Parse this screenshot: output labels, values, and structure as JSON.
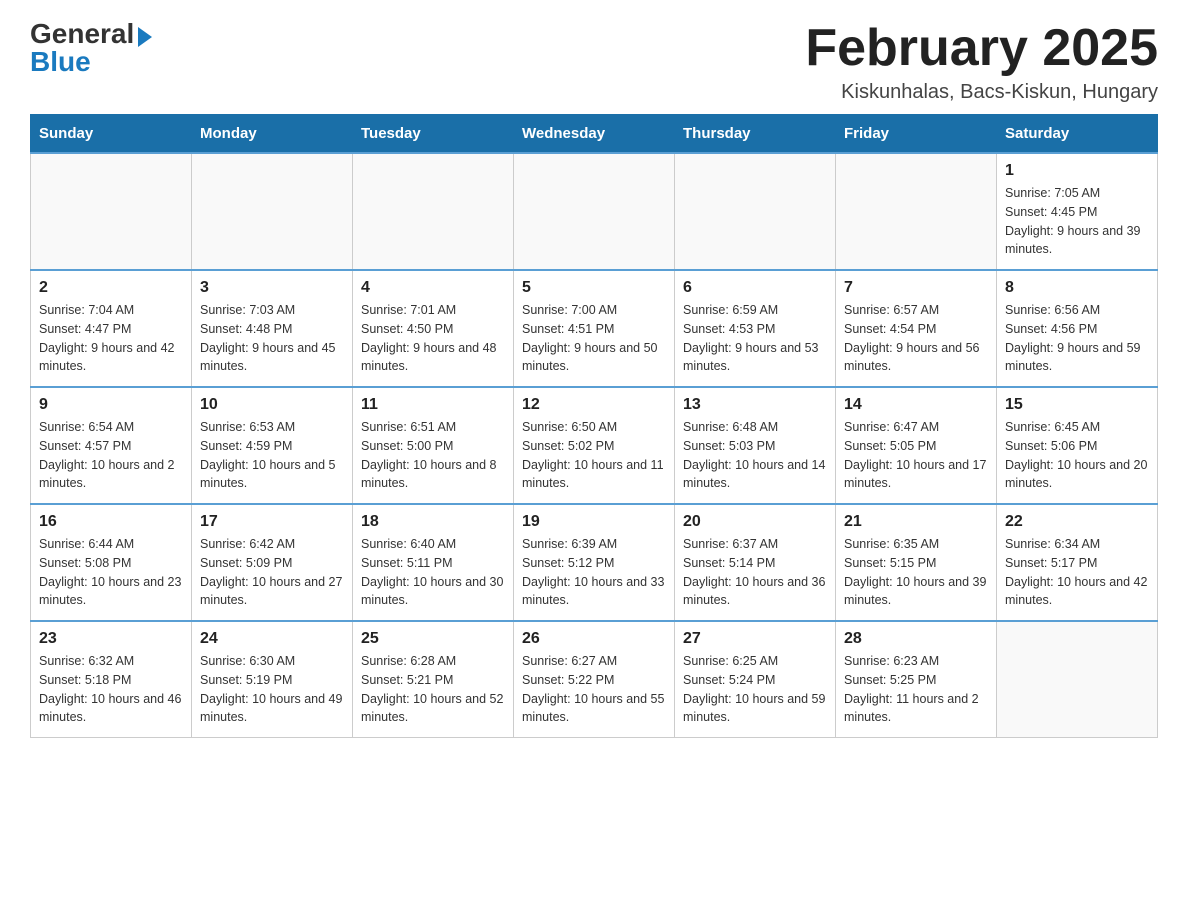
{
  "logo": {
    "general": "General",
    "blue": "Blue",
    "arrow": "▶"
  },
  "title": "February 2025",
  "location": "Kiskunhalas, Bacs-Kiskun, Hungary",
  "days_of_week": [
    "Sunday",
    "Monday",
    "Tuesday",
    "Wednesday",
    "Thursday",
    "Friday",
    "Saturday"
  ],
  "weeks": [
    [
      {
        "day": "",
        "detail": "",
        "empty": true
      },
      {
        "day": "",
        "detail": "",
        "empty": true
      },
      {
        "day": "",
        "detail": "",
        "empty": true
      },
      {
        "day": "",
        "detail": "",
        "empty": true
      },
      {
        "day": "",
        "detail": "",
        "empty": true
      },
      {
        "day": "",
        "detail": "",
        "empty": true
      },
      {
        "day": "1",
        "detail": "Sunrise: 7:05 AM\nSunset: 4:45 PM\nDaylight: 9 hours and 39 minutes."
      }
    ],
    [
      {
        "day": "2",
        "detail": "Sunrise: 7:04 AM\nSunset: 4:47 PM\nDaylight: 9 hours and 42 minutes."
      },
      {
        "day": "3",
        "detail": "Sunrise: 7:03 AM\nSunset: 4:48 PM\nDaylight: 9 hours and 45 minutes."
      },
      {
        "day": "4",
        "detail": "Sunrise: 7:01 AM\nSunset: 4:50 PM\nDaylight: 9 hours and 48 minutes."
      },
      {
        "day": "5",
        "detail": "Sunrise: 7:00 AM\nSunset: 4:51 PM\nDaylight: 9 hours and 50 minutes."
      },
      {
        "day": "6",
        "detail": "Sunrise: 6:59 AM\nSunset: 4:53 PM\nDaylight: 9 hours and 53 minutes."
      },
      {
        "day": "7",
        "detail": "Sunrise: 6:57 AM\nSunset: 4:54 PM\nDaylight: 9 hours and 56 minutes."
      },
      {
        "day": "8",
        "detail": "Sunrise: 6:56 AM\nSunset: 4:56 PM\nDaylight: 9 hours and 59 minutes."
      }
    ],
    [
      {
        "day": "9",
        "detail": "Sunrise: 6:54 AM\nSunset: 4:57 PM\nDaylight: 10 hours and 2 minutes."
      },
      {
        "day": "10",
        "detail": "Sunrise: 6:53 AM\nSunset: 4:59 PM\nDaylight: 10 hours and 5 minutes."
      },
      {
        "day": "11",
        "detail": "Sunrise: 6:51 AM\nSunset: 5:00 PM\nDaylight: 10 hours and 8 minutes."
      },
      {
        "day": "12",
        "detail": "Sunrise: 6:50 AM\nSunset: 5:02 PM\nDaylight: 10 hours and 11 minutes."
      },
      {
        "day": "13",
        "detail": "Sunrise: 6:48 AM\nSunset: 5:03 PM\nDaylight: 10 hours and 14 minutes."
      },
      {
        "day": "14",
        "detail": "Sunrise: 6:47 AM\nSunset: 5:05 PM\nDaylight: 10 hours and 17 minutes."
      },
      {
        "day": "15",
        "detail": "Sunrise: 6:45 AM\nSunset: 5:06 PM\nDaylight: 10 hours and 20 minutes."
      }
    ],
    [
      {
        "day": "16",
        "detail": "Sunrise: 6:44 AM\nSunset: 5:08 PM\nDaylight: 10 hours and 23 minutes."
      },
      {
        "day": "17",
        "detail": "Sunrise: 6:42 AM\nSunset: 5:09 PM\nDaylight: 10 hours and 27 minutes."
      },
      {
        "day": "18",
        "detail": "Sunrise: 6:40 AM\nSunset: 5:11 PM\nDaylight: 10 hours and 30 minutes."
      },
      {
        "day": "19",
        "detail": "Sunrise: 6:39 AM\nSunset: 5:12 PM\nDaylight: 10 hours and 33 minutes."
      },
      {
        "day": "20",
        "detail": "Sunrise: 6:37 AM\nSunset: 5:14 PM\nDaylight: 10 hours and 36 minutes."
      },
      {
        "day": "21",
        "detail": "Sunrise: 6:35 AM\nSunset: 5:15 PM\nDaylight: 10 hours and 39 minutes."
      },
      {
        "day": "22",
        "detail": "Sunrise: 6:34 AM\nSunset: 5:17 PM\nDaylight: 10 hours and 42 minutes."
      }
    ],
    [
      {
        "day": "23",
        "detail": "Sunrise: 6:32 AM\nSunset: 5:18 PM\nDaylight: 10 hours and 46 minutes."
      },
      {
        "day": "24",
        "detail": "Sunrise: 6:30 AM\nSunset: 5:19 PM\nDaylight: 10 hours and 49 minutes."
      },
      {
        "day": "25",
        "detail": "Sunrise: 6:28 AM\nSunset: 5:21 PM\nDaylight: 10 hours and 52 minutes."
      },
      {
        "day": "26",
        "detail": "Sunrise: 6:27 AM\nSunset: 5:22 PM\nDaylight: 10 hours and 55 minutes."
      },
      {
        "day": "27",
        "detail": "Sunrise: 6:25 AM\nSunset: 5:24 PM\nDaylight: 10 hours and 59 minutes."
      },
      {
        "day": "28",
        "detail": "Sunrise: 6:23 AM\nSunset: 5:25 PM\nDaylight: 11 hours and 2 minutes."
      },
      {
        "day": "",
        "detail": "",
        "empty": true
      }
    ]
  ]
}
